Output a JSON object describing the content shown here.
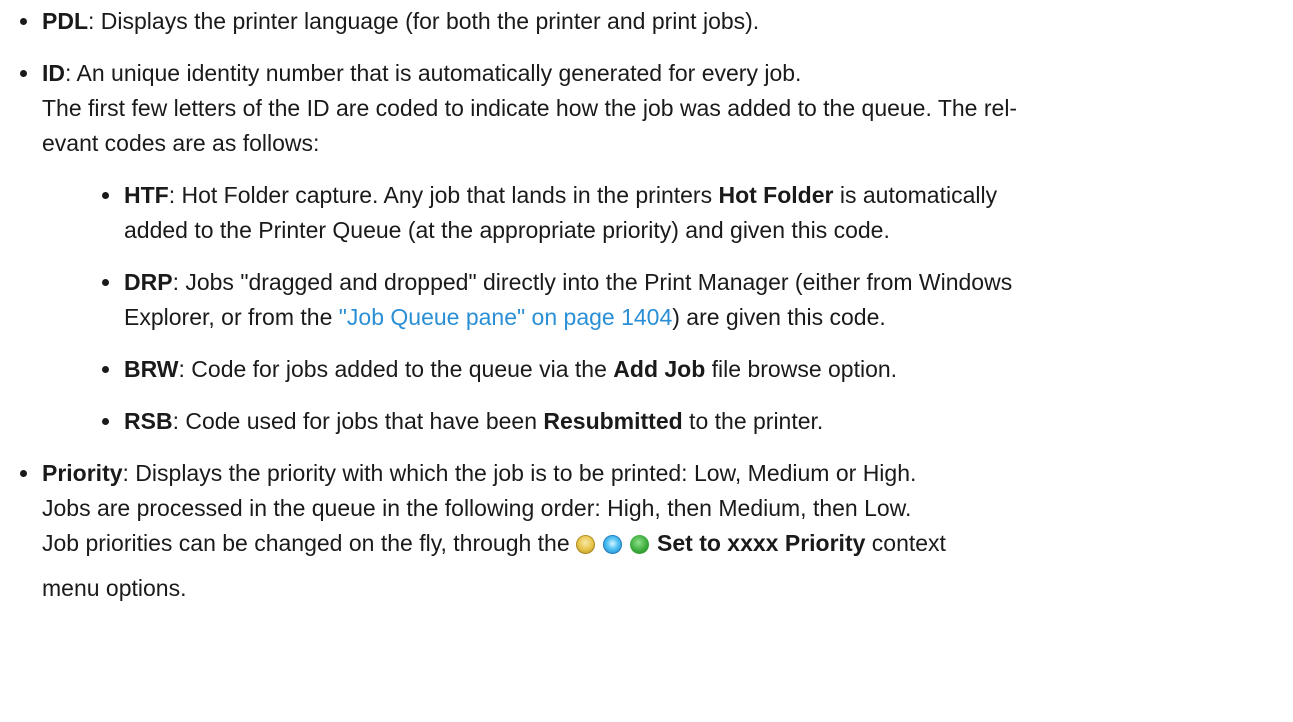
{
  "items": [
    {
      "term": "PDL",
      "text": ": Displays the printer language (for both the printer and print jobs)."
    },
    {
      "term": "ID",
      "text": ": An unique identity number that is automatically generated for every job.",
      "line2": "The first few letters of the ID are coded to indicate how the job was added to the queue. The rel-",
      "line3": "evant codes are as follows:",
      "codes": [
        {
          "term": "HTF",
          "pre": ": Hot Folder capture. Any job that lands in the printers ",
          "bold": "Hot Folder",
          "post": " is automatically",
          "line2": "added to the Printer Queue (at the appropriate priority) and given this code."
        },
        {
          "term": "DRP",
          "pre": ": Jobs \"dragged and dropped\" directly into the Print Manager (either from Windows",
          "line2_pre": "Explorer, or from the ",
          "link": "\"Job Queue pane\" on page 1404",
          "line2_post": ") are given this code."
        },
        {
          "term": "BRW",
          "pre": ": Code for jobs added to the queue via the ",
          "bold": "Add Job",
          "post": " file browse option."
        },
        {
          "term": "RSB",
          "pre": ": Code used for jobs that have been ",
          "bold": "Resubmitted",
          "post": " to the printer."
        }
      ]
    },
    {
      "term": "Priority",
      "text": ": Displays the priority with which the job is to be printed: Low, Medium or High.",
      "line2": "Jobs are processed in the queue in the following order: High, then Medium, then Low.",
      "line3_pre": "Job priorities can be changed on the fly, through the ",
      "bold": "Set to xxxx Priority",
      "line3_post": " context",
      "line4": "menu options."
    }
  ],
  "icons": {
    "low": "yellow-priority-icon",
    "medium": "blue-priority-icon",
    "high": "green-priority-icon"
  },
  "colors": {
    "link": "#2b8fd6",
    "text": "#1a1a1a"
  }
}
